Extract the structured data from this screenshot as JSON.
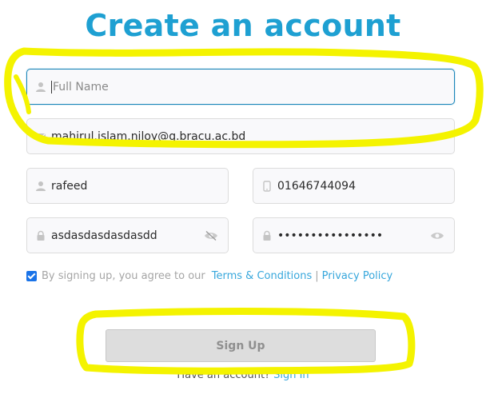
{
  "page": {
    "title": "Create an account"
  },
  "form": {
    "full_name": {
      "placeholder": "Full Name",
      "value": ""
    },
    "email": {
      "value": "mahirul.islam.niloy@g.bracu.ac.bd"
    },
    "username": {
      "value": "rafeed"
    },
    "phone": {
      "value": "01646744094"
    },
    "password": {
      "value": "asdasdasdasdasdd"
    },
    "confirm_password": {
      "value": "••••••••••••••••"
    }
  },
  "agreement": {
    "checked": true,
    "text": "By signing up, you agree to our",
    "terms_label": "Terms & Conditions",
    "separator": "|",
    "privacy_label": "Privacy Policy"
  },
  "actions": {
    "signup_label": "Sign Up",
    "have_account_text": "Have an account?",
    "signin_label": "Sign In"
  },
  "colors": {
    "title": "#1ea0d2",
    "link": "#37a7dc",
    "highlight": "#f4f300",
    "focus_border": "#1a86b9"
  },
  "icons": [
    "user-icon",
    "mail-icon",
    "phone-icon",
    "lock-icon",
    "eye-slash-icon",
    "eye-icon"
  ]
}
